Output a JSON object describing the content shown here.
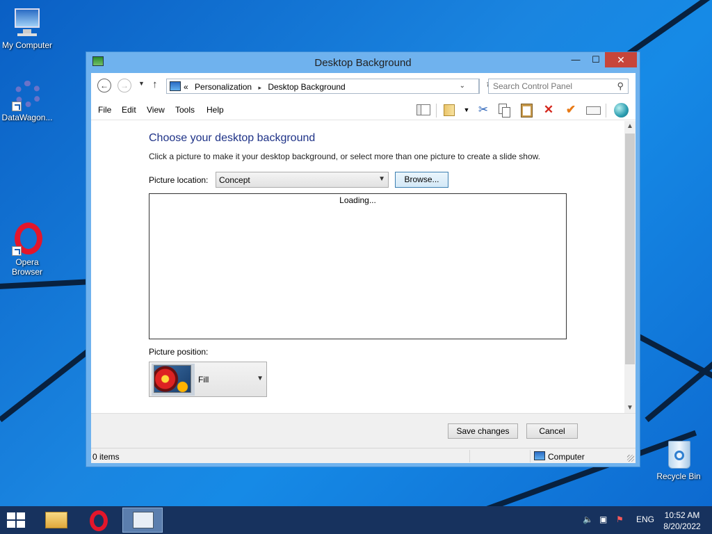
{
  "desktop": {
    "icons": [
      {
        "label": "My Computer"
      },
      {
        "label": "DataWagon..."
      },
      {
        "label": "Opera Browser"
      },
      {
        "label": "Recycle Bin"
      }
    ]
  },
  "window": {
    "title": "Desktop Background",
    "controls": {
      "minimize": "—",
      "maximize": "☐",
      "close": "✕"
    },
    "address": {
      "crumb_prefix": "«",
      "crumbs": [
        "Personalization",
        "Desktop Background"
      ],
      "separator": "▸"
    },
    "search": {
      "placeholder": "Search Control Panel"
    },
    "menu": [
      "File",
      "Edit",
      "View",
      "Tools",
      "Help"
    ],
    "content": {
      "heading": "Choose your desktop background",
      "subtitle": "Click a picture to make it your desktop background, or select more than one picture to create a slide show.",
      "picture_location_label": "Picture location:",
      "picture_location_value": "Concept",
      "browse_label": "Browse...",
      "loading_text": "Loading...",
      "picture_position_label": "Picture position:",
      "picture_position_value": "Fill"
    },
    "buttons": {
      "save": "Save changes",
      "cancel": "Cancel"
    },
    "status": {
      "items": "0 items",
      "location": "Computer"
    }
  },
  "taskbar": {
    "language": "ENG",
    "time": "10:52 AM",
    "date": "8/20/2022"
  },
  "colors": {
    "heading": "#1e3287",
    "close_button": "#c7453a",
    "taskbar": "#17325e",
    "titlebar": "#6fb2ee"
  }
}
